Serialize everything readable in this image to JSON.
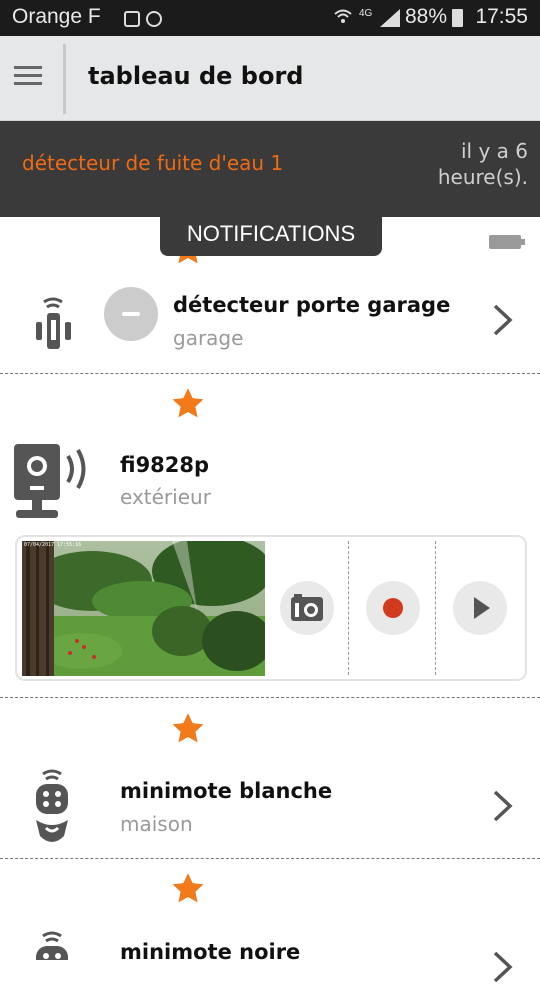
{
  "status_bar": {
    "carrier": "Orange F",
    "network": "4G",
    "battery": "88%",
    "time": "17:55"
  },
  "app_bar": {
    "title": "tableau de bord"
  },
  "notification_banner": {
    "message": "détecteur de fuite d'eau 1",
    "time_ago": "il y a 6 heure(s)."
  },
  "notifications_tab": {
    "label": "NOTIFICATIONS"
  },
  "devices": [
    {
      "name": "détecteur porte garage",
      "room": "garage",
      "icon": "door-sensor-icon",
      "state": "closed"
    },
    {
      "name": "fi9828p",
      "room": "extérieur",
      "icon": "camera-icon"
    },
    {
      "name": "minimote blanche",
      "room": "maison",
      "icon": "remote-icon"
    },
    {
      "name": "minimote noire",
      "icon": "remote-icon"
    }
  ],
  "camera": {
    "snapshot_date": "07/04/2017 17:55:16",
    "buttons": [
      "snapshot-icon",
      "record-icon",
      "play-icon"
    ]
  },
  "colors": {
    "accent": "#f27a1a",
    "banner_bg": "#3a3a3a",
    "appbar_bg": "#e6e7e8"
  }
}
